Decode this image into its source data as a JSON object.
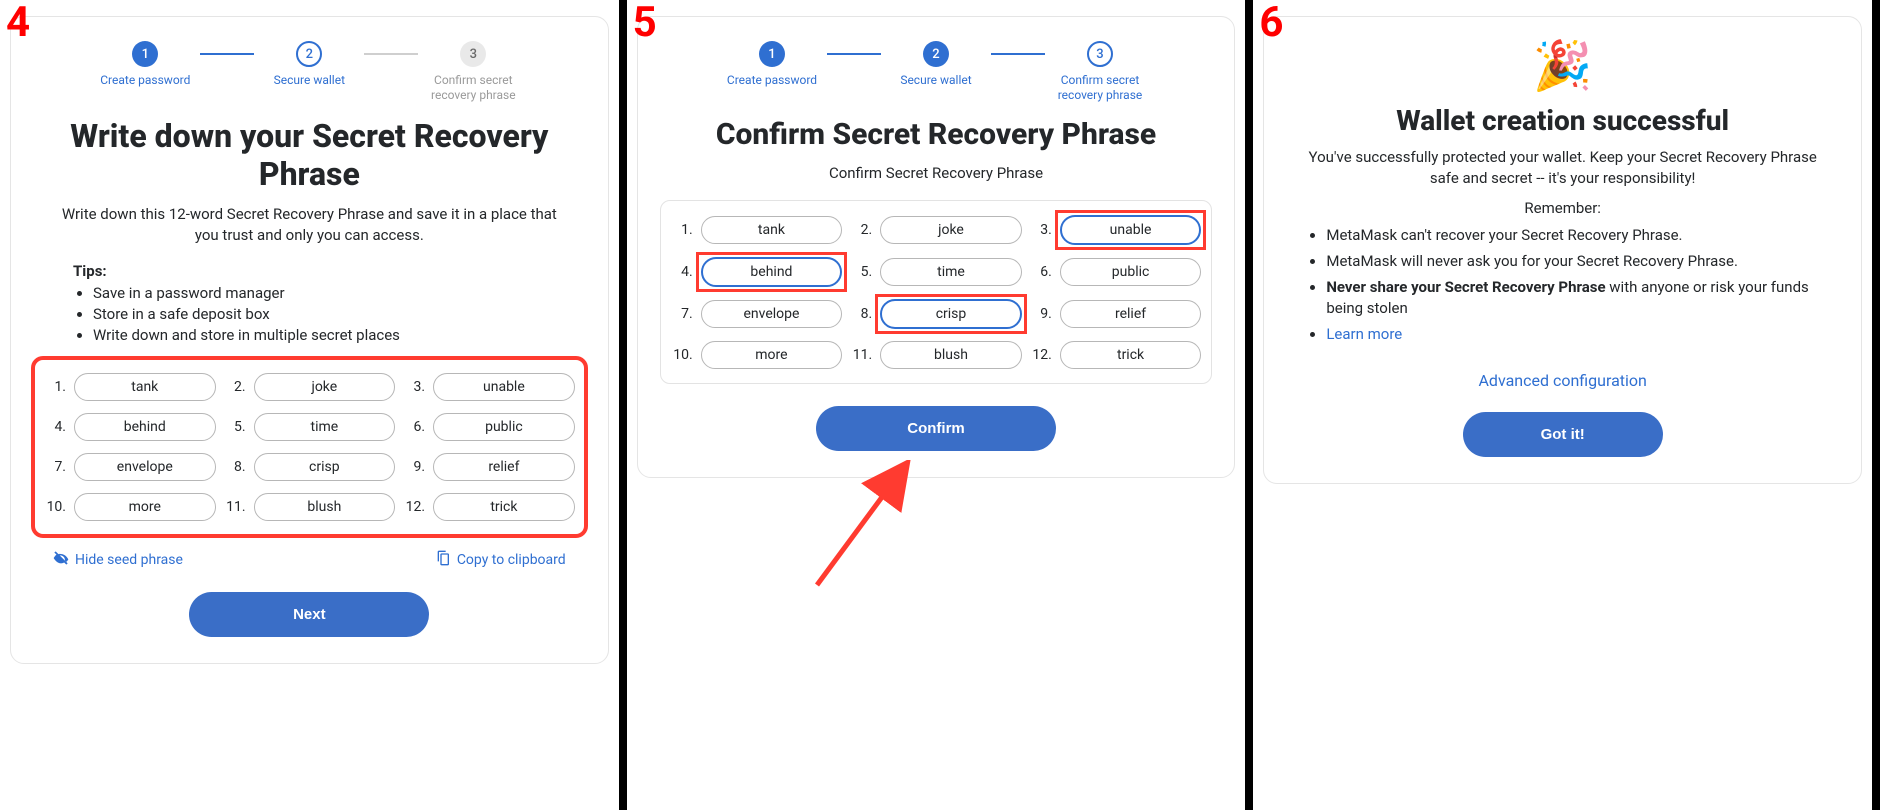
{
  "panels": {
    "p4": "4",
    "p5": "5",
    "p6": "6"
  },
  "stepper": {
    "s1": {
      "num": "1",
      "label": "Create password"
    },
    "s2": {
      "num": "2",
      "label": "Secure wallet"
    },
    "s3": {
      "num": "3",
      "label": "Confirm secret\nrecovery phrase"
    }
  },
  "panel4": {
    "title": "Write down your Secret Recovery Phrase",
    "subtitle": "Write down this 12-word Secret Recovery Phrase and save it in a place that you trust and only you can access.",
    "tips_head": "Tips:",
    "tips": [
      "Save in a password manager",
      "Store in a safe deposit box",
      "Write down and store in multiple secret places"
    ],
    "hide_label": "Hide seed phrase",
    "copy_label": "Copy to clipboard",
    "next": "Next"
  },
  "words": [
    {
      "n": "1.",
      "w": "tank"
    },
    {
      "n": "2.",
      "w": "joke"
    },
    {
      "n": "3.",
      "w": "unable"
    },
    {
      "n": "4.",
      "w": "behind"
    },
    {
      "n": "5.",
      "w": "time"
    },
    {
      "n": "6.",
      "w": "public"
    },
    {
      "n": "7.",
      "w": "envelope"
    },
    {
      "n": "8.",
      "w": "crisp"
    },
    {
      "n": "9.",
      "w": "relief"
    },
    {
      "n": "10.",
      "w": "more"
    },
    {
      "n": "11.",
      "w": "blush"
    },
    {
      "n": "12.",
      "w": "trick"
    }
  ],
  "panel5": {
    "title": "Confirm Secret Recovery Phrase",
    "subtitle": "Confirm Secret Recovery Phrase",
    "confirm": "Confirm",
    "highlight_idx": [
      2,
      3,
      7
    ]
  },
  "panel6": {
    "title": "Wallet creation successful",
    "desc": "You've successfully protected your wallet. Keep your Secret Recovery Phrase safe and secret -- it's your responsibility!",
    "remember": "Remember:",
    "b1": "MetaMask can't recover your Secret Recovery Phrase.",
    "b2": "MetaMask will never ask you for your Secret Recovery Phrase.",
    "b3a": "Never share your Secret Recovery Phrase",
    "b3b": " with anyone or risk your funds being stolen",
    "learn_more": "Learn more",
    "advanced": "Advanced configuration",
    "gotit": "Got it!"
  }
}
